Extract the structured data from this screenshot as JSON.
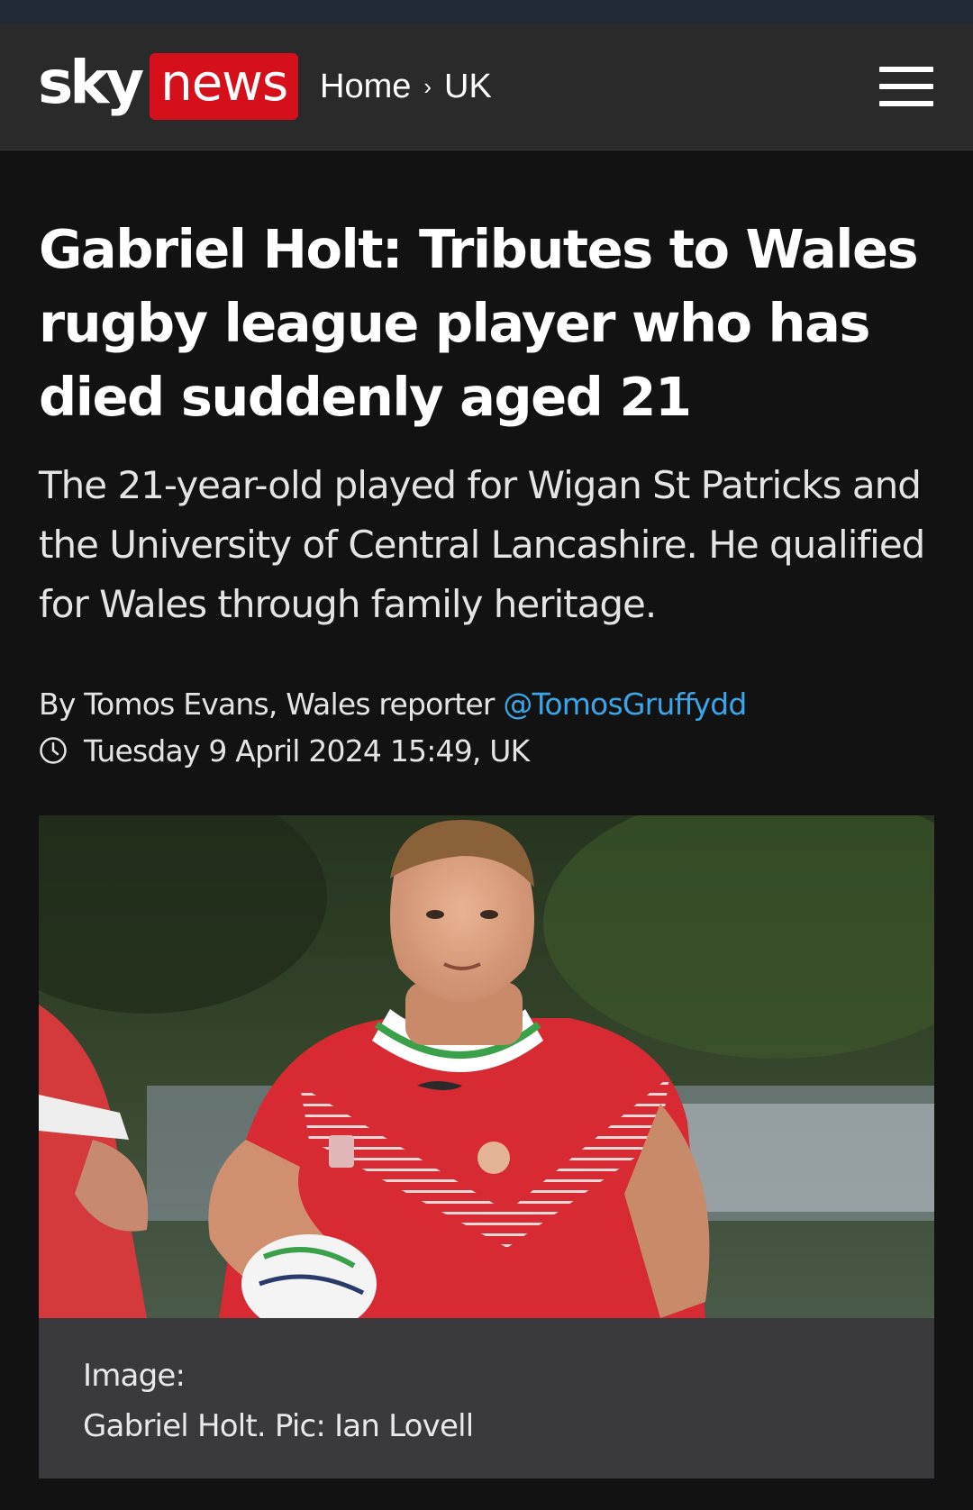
{
  "header": {
    "logo_sky": "sky",
    "logo_news": "news",
    "breadcrumb": {
      "home": "Home",
      "separator": "›",
      "section": "UK"
    },
    "menu_icon": "hamburger-menu-icon"
  },
  "article": {
    "headline": "Gabriel Holt: Tributes to Wales rugby league player who has died suddenly aged 21",
    "standfirst": "The 21-year-old played for Wigan St Patricks and the University of Central Lancashire. He qualified for Wales through family heritage.",
    "byline": {
      "author": "By Tomos Evans, Wales reporter",
      "twitter_handle": "@TomosGruffydd"
    },
    "timestamp": "Tuesday 9 April 2024 15:49, UK",
    "image": {
      "label": "Image:",
      "caption": "Gabriel Holt. Pic: Ian Lovell"
    }
  },
  "colors": {
    "page_background": "#121212",
    "header_background": "#2a2a2a",
    "brand_red": "#d6101a",
    "link_blue": "#3aa6e8",
    "caption_background": "#3a3a3d"
  }
}
